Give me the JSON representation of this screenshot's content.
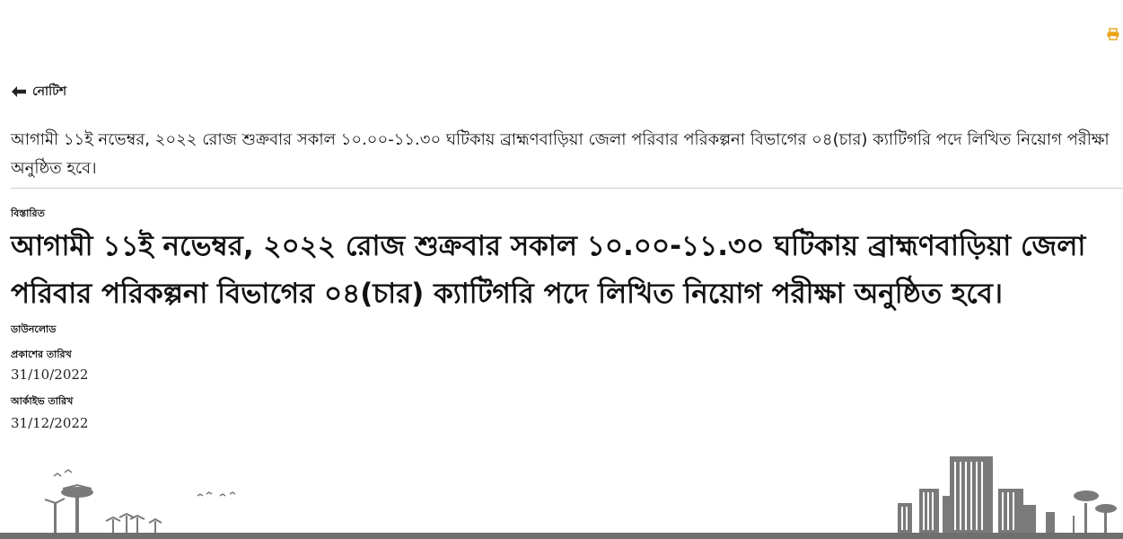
{
  "header": {
    "print_icon": "printer-icon",
    "accent_color": "#e8a317"
  },
  "nav": {
    "back_icon": "arrow-left-icon",
    "back_label": "নোটিশ"
  },
  "notice": {
    "summary": "আগামী ১১ই নভেম্বর, ২০২২ রোজ শুক্রবার সকাল ১০.০০-১১.৩০ ঘটিকায় ব্রাহ্মণবাড়িয়া জেলা পরিবার পরিকল্পনা বিভাগের ০৪(চার) ক্যাটিগরি পদে লিখিত নিয়োগ পরীক্ষা অনুষ্ঠিত হবে।",
    "details_label": "বিস্তারিত",
    "details_body": "আগামী ১১ই নভেম্বর, ২০২২ রোজ শুক্রবার সকাল ১০.০০-১১.৩০ ঘটিকায়  ব্রাহ্মণবাড়িয়া জেলা পরিবার পরিকল্পনা বিভাগের ০৪(চার) ক্যাটিগরি পদে লিখিত নিয়োগ পরীক্ষা  অনুষ্ঠিত হবে।",
    "download_label": "ডাউনলোড",
    "published_label": "প্রকাশের তারিখ",
    "published_date": "31/10/2022",
    "archive_label": "আর্কাইভ তারিখ",
    "archive_date": "31/12/2022"
  },
  "footer": {
    "illustration": "city-landscape-illustration"
  }
}
